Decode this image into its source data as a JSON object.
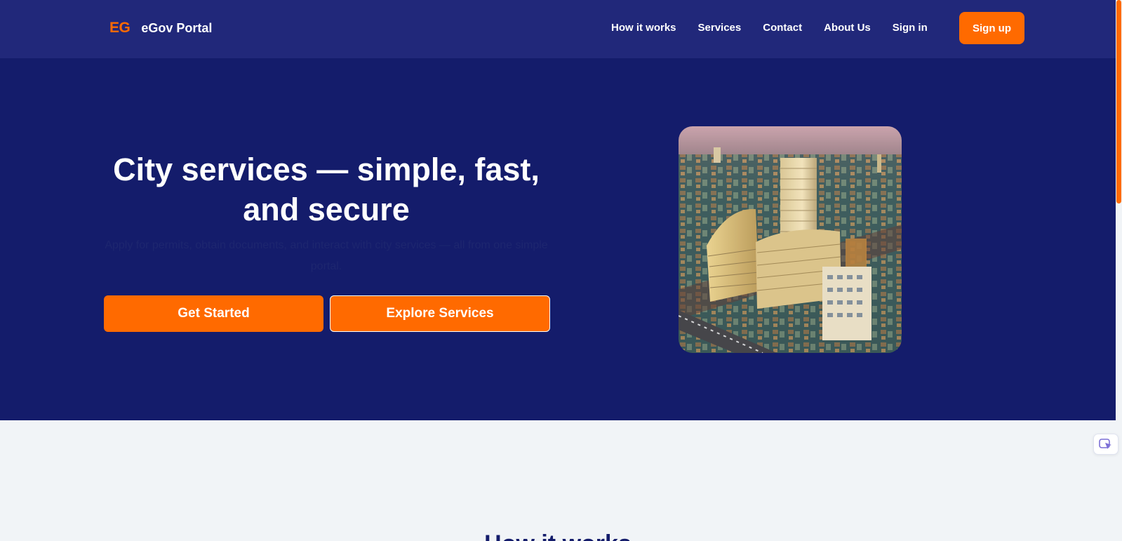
{
  "brand": {
    "mark": "EG",
    "name": "eGov Portal"
  },
  "nav": {
    "links": [
      "How it works",
      "Services",
      "Contact",
      "About Us",
      "Sign in"
    ],
    "signup_label": "Sign up"
  },
  "hero": {
    "title": "City services — simple, fast, and secure",
    "subtitle": "Apply for permits, obtain documents, and interact with city services — all from one simple portal.",
    "primary_label": "Get Started",
    "secondary_label": "Explore Services"
  },
  "next_section": {
    "heading": "How it works"
  },
  "colors": {
    "accent": "#ff6a00",
    "navbar": "#21287a",
    "hero": "#141c6b",
    "page": "#f1f4f7"
  },
  "icons": {
    "floating_widget": "pointer-icon"
  }
}
